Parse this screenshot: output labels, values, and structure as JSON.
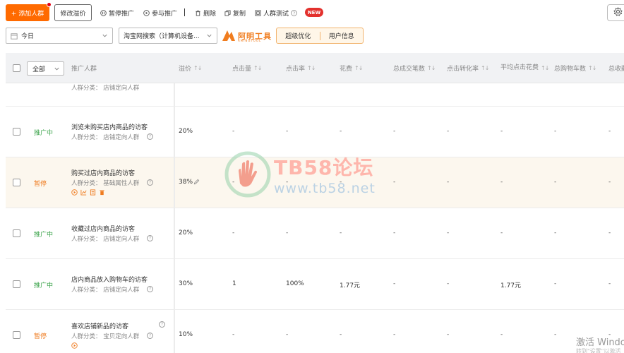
{
  "toolbar": {
    "add_label": "+ 添加人群",
    "modify_bid_label": "修改溢价",
    "pause_label": "暂停推广",
    "join_label": "参与推广",
    "delete_label": "删除",
    "copy_label": "复制",
    "test_label": "人群测试",
    "new_badge": "NEW"
  },
  "filters": {
    "date": "今日",
    "channel": "淘宝网搜索（计算机设备..."
  },
  "brand": {
    "logo_text": "阿明工具",
    "logo_sub": "AMINGTOOL"
  },
  "tabs": [
    {
      "label": "超级优化"
    },
    {
      "label": "用户信息"
    }
  ],
  "table": {
    "all_select": "全部",
    "headers": {
      "crowd": "推广人群",
      "bid": "溢价",
      "clicks": "点击量",
      "ctr": "点击率",
      "cost": "花费",
      "orders": "总成交笔数",
      "cvr": "点击转化率",
      "cpc": "平均点击花费",
      "cart": "总购物车数",
      "fav": "总收藏"
    },
    "partial_row": {
      "category": "人群分类：  店铺定向人群"
    },
    "rows": [
      {
        "status": "推广中",
        "name": "浏览未购买店内商品的访客",
        "category": "人群分类：  店铺定向人群",
        "bid": "20%",
        "clicks": "-",
        "ctr": "-",
        "cost": "-",
        "orders": "-",
        "cvr": "-",
        "cpc": "-",
        "cart": "-",
        "fav": "-"
      },
      {
        "status": "暂停",
        "name": "购买过店内商品的访客",
        "category": "人群分类：  基础属性人群",
        "bid": "38%",
        "clicks": "-",
        "ctr": "-",
        "cost": "-",
        "orders": "-",
        "cvr": "-",
        "cpc": "-",
        "cart": "-",
        "fav": "-"
      },
      {
        "status": "推广中",
        "name": "收藏过店内商品的访客",
        "category": "人群分类：  店铺定向人群",
        "bid": "20%",
        "clicks": "-",
        "ctr": "-",
        "cost": "-",
        "orders": "-",
        "cvr": "-",
        "cpc": "-",
        "cart": "-",
        "fav": "-"
      },
      {
        "status": "推广中",
        "name": "店内商品放入购物车的访客",
        "category": "人群分类：  店铺定向人群",
        "bid": "30%",
        "clicks": "1",
        "ctr": "100%",
        "cost": "1.77元",
        "orders": "-",
        "cvr": "-",
        "cpc": "1.77元",
        "cart": "-",
        "fav": "-"
      },
      {
        "status": "暂停",
        "name": "喜欢店铺新品的访客",
        "category": "人群分类：  宝贝定向人群",
        "bid": "10%",
        "clicks": "-",
        "ctr": "-",
        "cost": "-",
        "orders": "-",
        "cvr": "-",
        "cpc": "-",
        "cart": "-",
        "fav": "-"
      }
    ]
  },
  "watermark": {
    "title": "TB58论坛",
    "url": "www.tb58.net"
  },
  "os_overlay": {
    "text": "激活 Windo",
    "sub": "转到\"设置\"以激活"
  },
  "colors": {
    "accent": "#ff6a00",
    "status_on": "#3aa34a",
    "status_off": "#ef7b1f",
    "new_badge": "#e3312d"
  }
}
